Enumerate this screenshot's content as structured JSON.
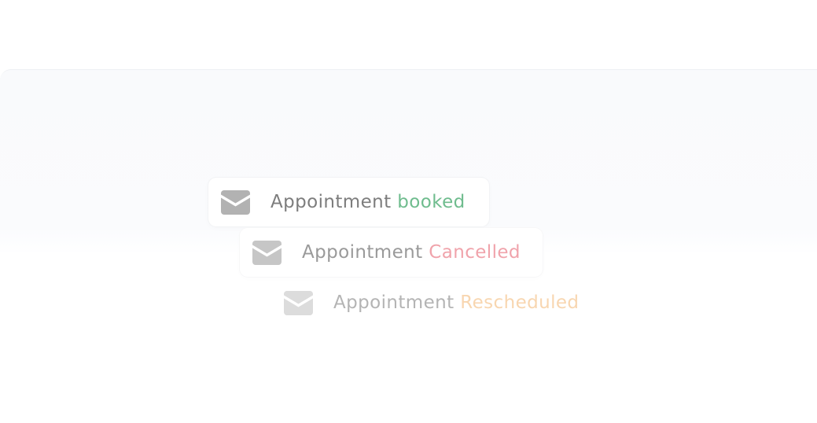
{
  "notifications": [
    {
      "label": "Appointment",
      "status": "booked",
      "status_color": "#6fbc8e",
      "icon": "mail-icon"
    },
    {
      "label": "Appointment",
      "status": "Cancelled",
      "status_color": "#f0a3ab",
      "icon": "mail-icon"
    },
    {
      "label": "Appointment",
      "status": "Rescheduled",
      "status_color": "#f8d6b0",
      "icon": "mail-icon"
    }
  ]
}
